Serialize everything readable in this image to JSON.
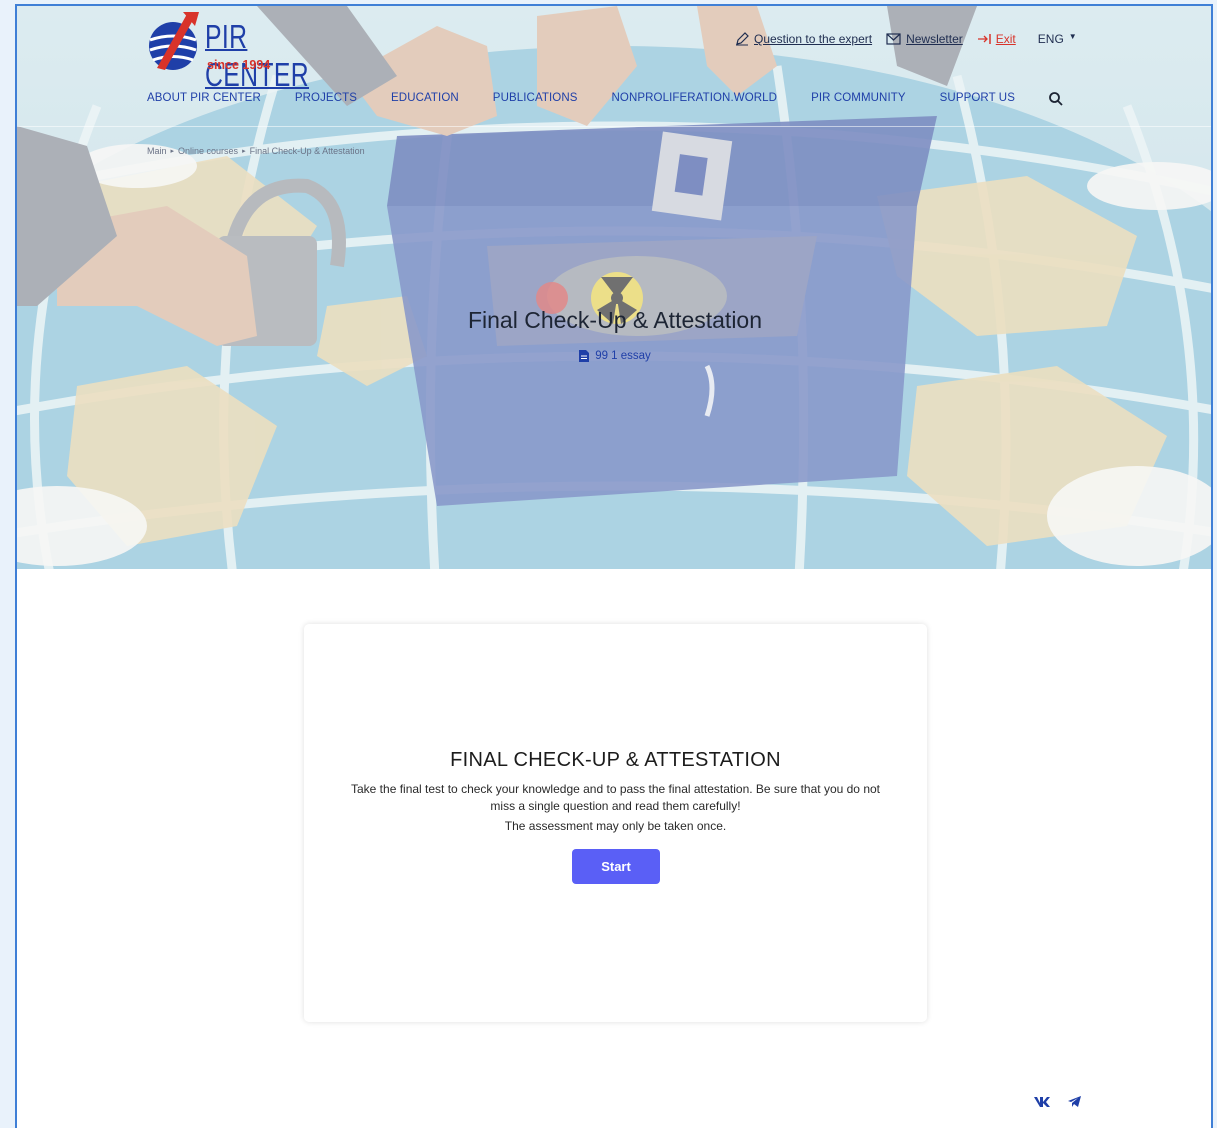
{
  "header": {
    "logo": {
      "name": "PIR CENTER",
      "since": "since 1994"
    },
    "top_links": {
      "question": "Question to the expert",
      "newsletter": "Newsletter",
      "exit": "Exit",
      "language": "ENG"
    },
    "nav": [
      "ABOUT PIR CENTER",
      "PROJECTS",
      "EDUCATION",
      "PUBLICATIONS",
      "NONPROLIFERATION.WORLD",
      "PIR COMMUNITY",
      "SUPPORT US"
    ]
  },
  "breadcrumb": [
    "Main",
    "Online courses",
    "Final Check-Up & Attestation"
  ],
  "hero": {
    "title": "Final Check-Up & Attestation",
    "meta": "99 1 essay"
  },
  "card": {
    "title": "FINAL CHECK-UP & ATTESTATION",
    "description": "Take the final test to check your knowledge and to pass the final attestation. Be sure that you do not miss a single question and read them carefully!",
    "note": "The assessment may only be taken once.",
    "start_label": "Start"
  },
  "social": [
    "vk-icon",
    "telegram-icon"
  ],
  "colors": {
    "accent": "#5a5ff6",
    "nav_blue": "#1f3fa8",
    "exit_red": "#d8332a",
    "frame_border": "#3f7fd6"
  }
}
